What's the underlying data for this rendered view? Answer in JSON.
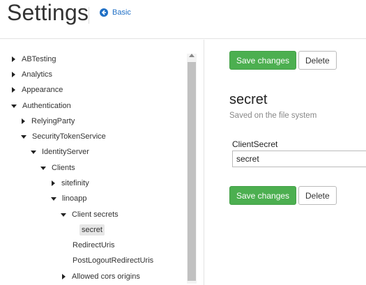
{
  "header": {
    "title": "Settings",
    "back_link_label": "Basic"
  },
  "sidebar": {
    "tree": [
      {
        "label": "ABTesting",
        "state": "collapsed"
      },
      {
        "label": "Analytics",
        "state": "collapsed"
      },
      {
        "label": "Appearance",
        "state": "collapsed"
      },
      {
        "label": "Authentication",
        "state": "expanded"
      },
      {
        "label": "RelyingParty",
        "state": "collapsed"
      },
      {
        "label": "SecurityTokenService",
        "state": "expanded"
      },
      {
        "label": "IdentityServer",
        "state": "expanded"
      },
      {
        "label": "Clients",
        "state": "expanded"
      },
      {
        "label": "sitefinity",
        "state": "collapsed"
      },
      {
        "label": "linoapp",
        "state": "expanded"
      },
      {
        "label": "Client secrets",
        "state": "expanded"
      },
      {
        "label": "secret",
        "state": "selected-leaf"
      },
      {
        "label": "RedirectUris",
        "state": "leaf"
      },
      {
        "label": "PostLogoutRedirectUris",
        "state": "leaf"
      },
      {
        "label": "Allowed cors origins",
        "state": "collapsed"
      }
    ]
  },
  "content": {
    "save_label": "Save changes",
    "delete_label": "Delete",
    "section_title": "secret",
    "section_subtitle": "Saved on the file system",
    "field_label": "ClientSecret",
    "field_value": "secret"
  },
  "colors": {
    "primary_button": "#4caf50",
    "link": "#1f6fc5",
    "selected_bg": "#e6e6e6"
  }
}
